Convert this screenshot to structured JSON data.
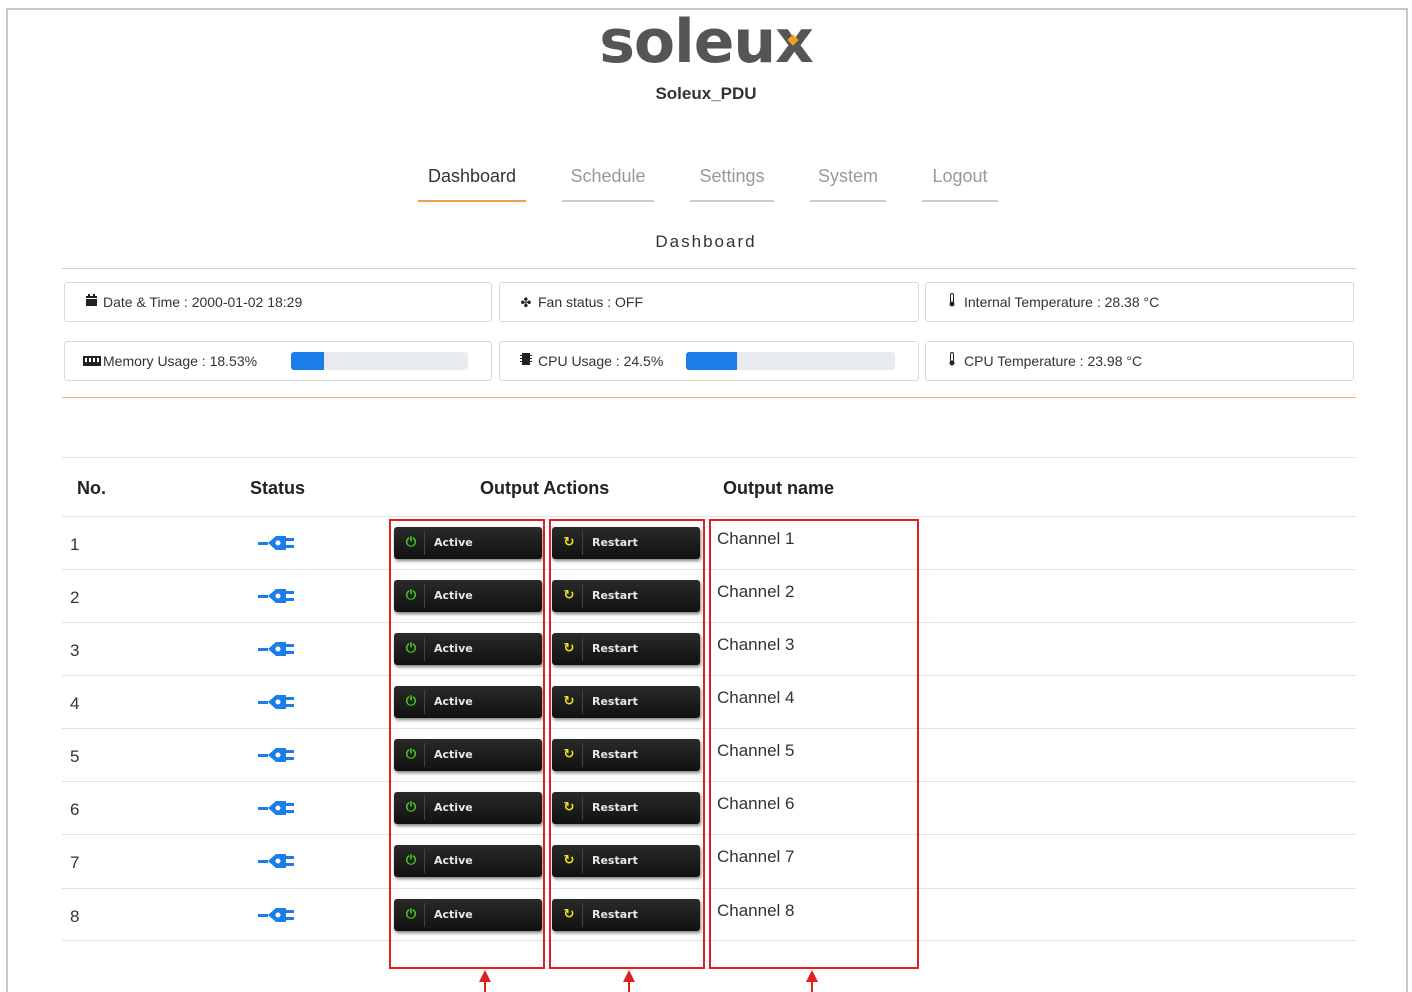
{
  "brand": {
    "logo": "soleux",
    "device_name": "Soleux_PDU"
  },
  "nav": [
    {
      "label": "Dashboard",
      "active": true
    },
    {
      "label": "Schedule",
      "active": false
    },
    {
      "label": "Settings",
      "active": false
    },
    {
      "label": "System",
      "active": false
    },
    {
      "label": "Logout",
      "active": false
    }
  ],
  "page_title": "Dashboard",
  "info": {
    "datetime": {
      "icon": "calendar-icon",
      "text": "Date & Time : 2000-01-02 18:29"
    },
    "fan": {
      "icon": "fan-icon",
      "text": "Fan status : OFF"
    },
    "internal_temp": {
      "icon": "thermometer-icon",
      "text": "Internal Temperature : 28.38 °C"
    },
    "memory": {
      "icon": "memory-icon",
      "text": "Memory Usage : 18.53%",
      "percent": 18.53
    },
    "cpu": {
      "icon": "cpu-icon",
      "text": "CPU Usage : 24.5%",
      "percent": 24.5
    },
    "cpu_temp": {
      "icon": "thermometer-icon",
      "text": "CPU Temperature : 23.98 °C"
    }
  },
  "table": {
    "headers": {
      "no": "No.",
      "status": "Status",
      "actions": "Output Actions",
      "name": "Output name"
    },
    "rows": [
      {
        "no": "1",
        "status_icon": "plug-icon",
        "active_label": "Active",
        "restart_label": "Restart",
        "name": "Channel 1"
      },
      {
        "no": "2",
        "status_icon": "plug-icon",
        "active_label": "Active",
        "restart_label": "Restart",
        "name": "Channel 2"
      },
      {
        "no": "3",
        "status_icon": "plug-icon",
        "active_label": "Active",
        "restart_label": "Restart",
        "name": "Channel 3"
      },
      {
        "no": "4",
        "status_icon": "plug-icon",
        "active_label": "Active",
        "restart_label": "Restart",
        "name": "Channel 4"
      },
      {
        "no": "5",
        "status_icon": "plug-icon",
        "active_label": "Active",
        "restart_label": "Restart",
        "name": "Channel 5"
      },
      {
        "no": "6",
        "status_icon": "plug-icon",
        "active_label": "Active",
        "restart_label": "Restart",
        "name": "Channel 6"
      },
      {
        "no": "7",
        "status_icon": "plug-icon",
        "active_label": "Active",
        "restart_label": "Restart",
        "name": "Channel 7"
      },
      {
        "no": "8",
        "status_icon": "plug-icon",
        "active_label": "Active",
        "restart_label": "Restart",
        "name": "Channel 8"
      }
    ]
  },
  "colors": {
    "accent": "#f0a050",
    "progress": "#1a7de8",
    "highlight": "#e02020",
    "plug": "#1a7de8"
  }
}
